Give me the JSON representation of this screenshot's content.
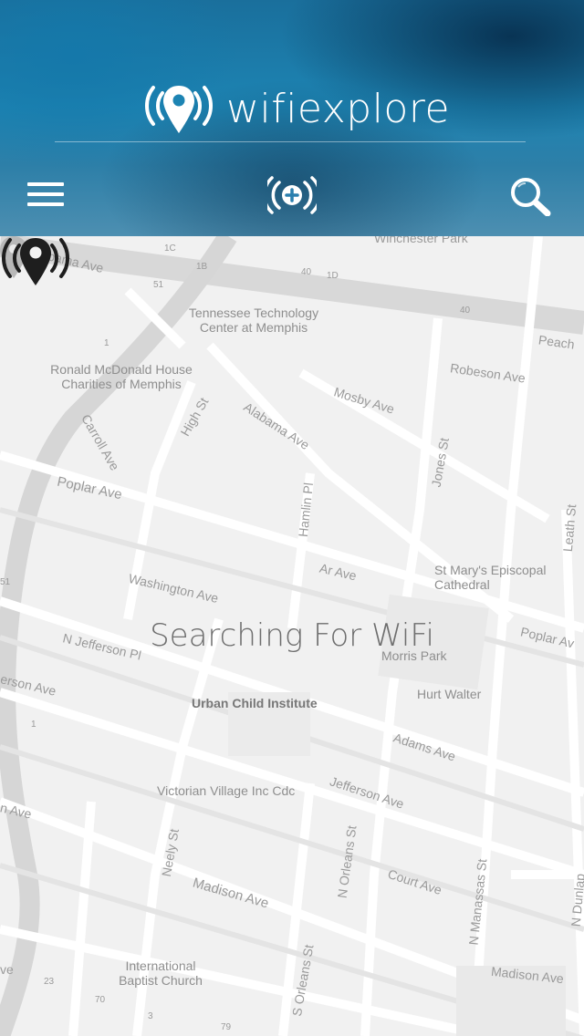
{
  "header": {
    "brand": "wifiexplore",
    "icons": {
      "logo": "wifi-location-pin-icon",
      "menu": "hamburger-menu-icon",
      "add": "add-wifi-hotspot-icon",
      "search": "search-icon"
    },
    "colors": {
      "header_blue": "#1d84b3",
      "text": "#ffffff"
    }
  },
  "status": {
    "text": "Searching For WiFi",
    "icon": "wifi-location-pin-icon"
  },
  "map": {
    "streets": [
      "Winchester Park",
      "Alabama Ave",
      "Alabama Ave",
      "Mosby Ave",
      "Robeson Ave",
      "Peach",
      "Carroll Ave",
      "High St",
      "Poplar Ave",
      "Hamlin Pl",
      "Jones St",
      "Leath St",
      "Washington Ave",
      "Ar Ave",
      "Poplar Av",
      "N Jefferson Pl",
      "erson Ave",
      "Adams Ave",
      "Jefferson Ave",
      "n Ave",
      "Neely St",
      "N Orleans St",
      "Court Ave",
      "N Manassas St",
      "N Dunlap",
      "Madison Ave",
      "Madison Ave",
      "S Orleans St",
      "ve"
    ],
    "places": [
      "Tennessee Technology\nCenter at Memphis",
      "Ronald McDonald House\nCharities of Memphis",
      "St Mary's Episcopal\nCathedral",
      "Morris Park",
      "Hurt Walter",
      "Urban Child Institute",
      "Victorian Village Inc Cdc",
      "International\nBaptist Church"
    ],
    "highway_shields": [
      "1C",
      "1B",
      "1D",
      "40",
      "40",
      "51",
      "1",
      "1",
      "51",
      "23",
      "70",
      "3",
      "79"
    ]
  }
}
